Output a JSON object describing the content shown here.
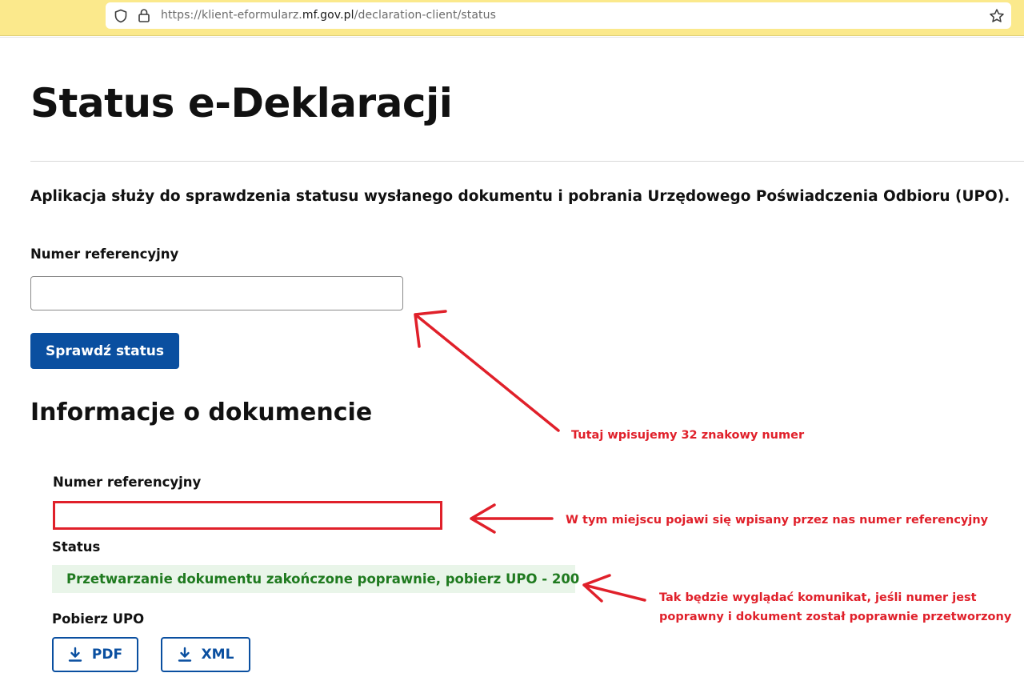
{
  "browser": {
    "url_prefix": "https://klient-eformularz.",
    "url_domain": "mf.gov.pl",
    "url_path": "/declaration-client/status"
  },
  "page": {
    "title": "Status e-Deklaracji",
    "intro": "Aplikacja służy do sprawdzenia statusu wysłanego dokumentu i pobrania Urzędowego Poświadczenia Odbioru (UPO).",
    "reference_label": "Numer referencyjny",
    "reference_value": "",
    "check_button": "Sprawdź status",
    "info_title": "Informacje o dokumencie",
    "info": {
      "reference_label": "Numer referencyjny",
      "reference_value": "",
      "status_label": "Status",
      "status_value": "Przetwarzanie dokumentu zakończone poprawnie, pobierz UPO - 200",
      "download_label": "Pobierz UPO",
      "pdf_button": "PDF",
      "xml_button": "XML"
    }
  },
  "annotations": {
    "input_note": "Tutaj wpisujemy 32 znakowy numer",
    "reference_note": "W tym miejscu pojawi się wpisany przez nas numer referencyjny",
    "status_note_line1": "Tak będzie wyglądać komunikat, jeśli numer jest",
    "status_note_line2": "poprawny i dokument został poprawnie przetworzony"
  },
  "colors": {
    "primary": "#0a4fa0",
    "success_text": "#1f7a1f",
    "success_bg": "#e9f5e9",
    "annotation": "#e0202a",
    "chrome": "#fbe98c"
  }
}
